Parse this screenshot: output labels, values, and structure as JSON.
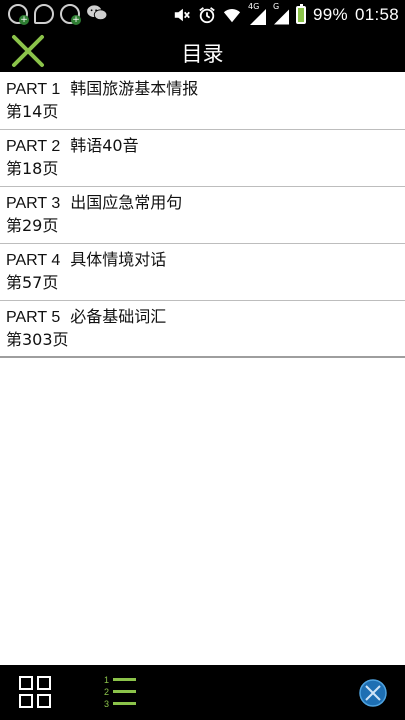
{
  "status_bar": {
    "battery_percent": "99%",
    "time": "01:58",
    "network_4g": "4G",
    "network_g": "G",
    "icons": [
      "app-notification-icon",
      "chat-bubble-icon",
      "app-update-icon",
      "wechat-icon",
      "mute-icon",
      "alarm-icon",
      "wifi-icon",
      "signal-4g-icon",
      "signal-g-icon",
      "battery-charging-icon"
    ]
  },
  "header": {
    "title": "目录",
    "close_icon": "close-x-icon",
    "accent_color": "#8bc34a"
  },
  "toc": {
    "items": [
      {
        "part": "PART 1",
        "title": "韩国旅游基本情报",
        "page": "第14页"
      },
      {
        "part": "PART 2",
        "title": "韩语40音",
        "page": "第18页"
      },
      {
        "part": "PART 3",
        "title": "出国应急常用句",
        "page": "第29页"
      },
      {
        "part": "PART 4",
        "title": "具体情境对话",
        "page": "第57页"
      },
      {
        "part": "PART 5",
        "title": "必备基础词汇",
        "page": "第303页"
      }
    ]
  },
  "bottom_bar": {
    "list_numbers": [
      "1",
      "2",
      "3"
    ],
    "buttons": [
      "grid-view-icon",
      "numbered-list-icon",
      "globe-icon"
    ]
  }
}
